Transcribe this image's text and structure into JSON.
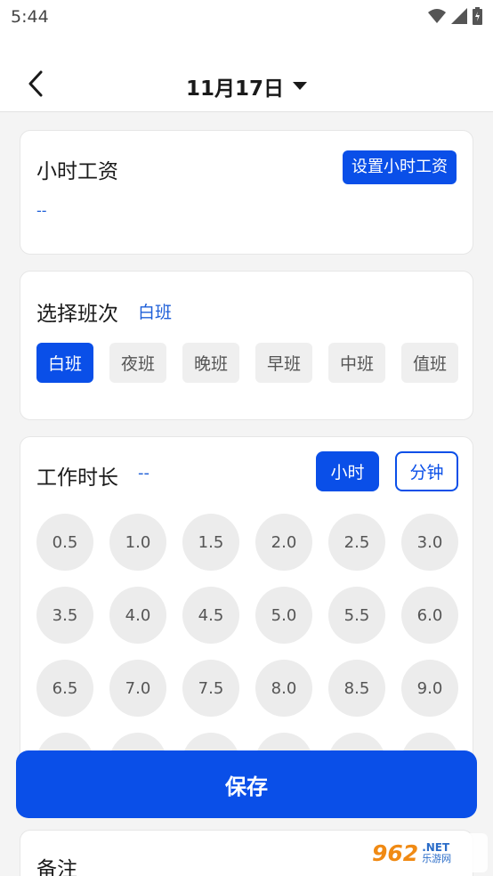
{
  "status_bar": {
    "time": "5:44"
  },
  "header": {
    "date": "11月17日"
  },
  "wage": {
    "title": "小时工资",
    "value": "--",
    "button": "设置小时工资"
  },
  "shift": {
    "title": "选择班次",
    "selected": "白班",
    "options": [
      "白班",
      "夜班",
      "晚班",
      "早班",
      "中班",
      "值班"
    ]
  },
  "hours": {
    "title": "工作时长",
    "value": "--",
    "unit_hour": "小时",
    "unit_minute": "分钟",
    "options": [
      "0.5",
      "1.0",
      "1.5",
      "2.0",
      "2.5",
      "3.0",
      "3.5",
      "4.0",
      "4.5",
      "5.0",
      "5.5",
      "6.0",
      "6.5",
      "7.0",
      "7.5",
      "8.0",
      "8.5",
      "9.0"
    ]
  },
  "save_button": "保存",
  "remark": {
    "title": "备注"
  },
  "watermark": {
    "number": "962",
    "net_top": ".NET",
    "net_bottom": "乐游网"
  },
  "colors": {
    "accent": "#0a4fe8",
    "link": "#1e5fd8",
    "background": "#f4f4f4"
  }
}
